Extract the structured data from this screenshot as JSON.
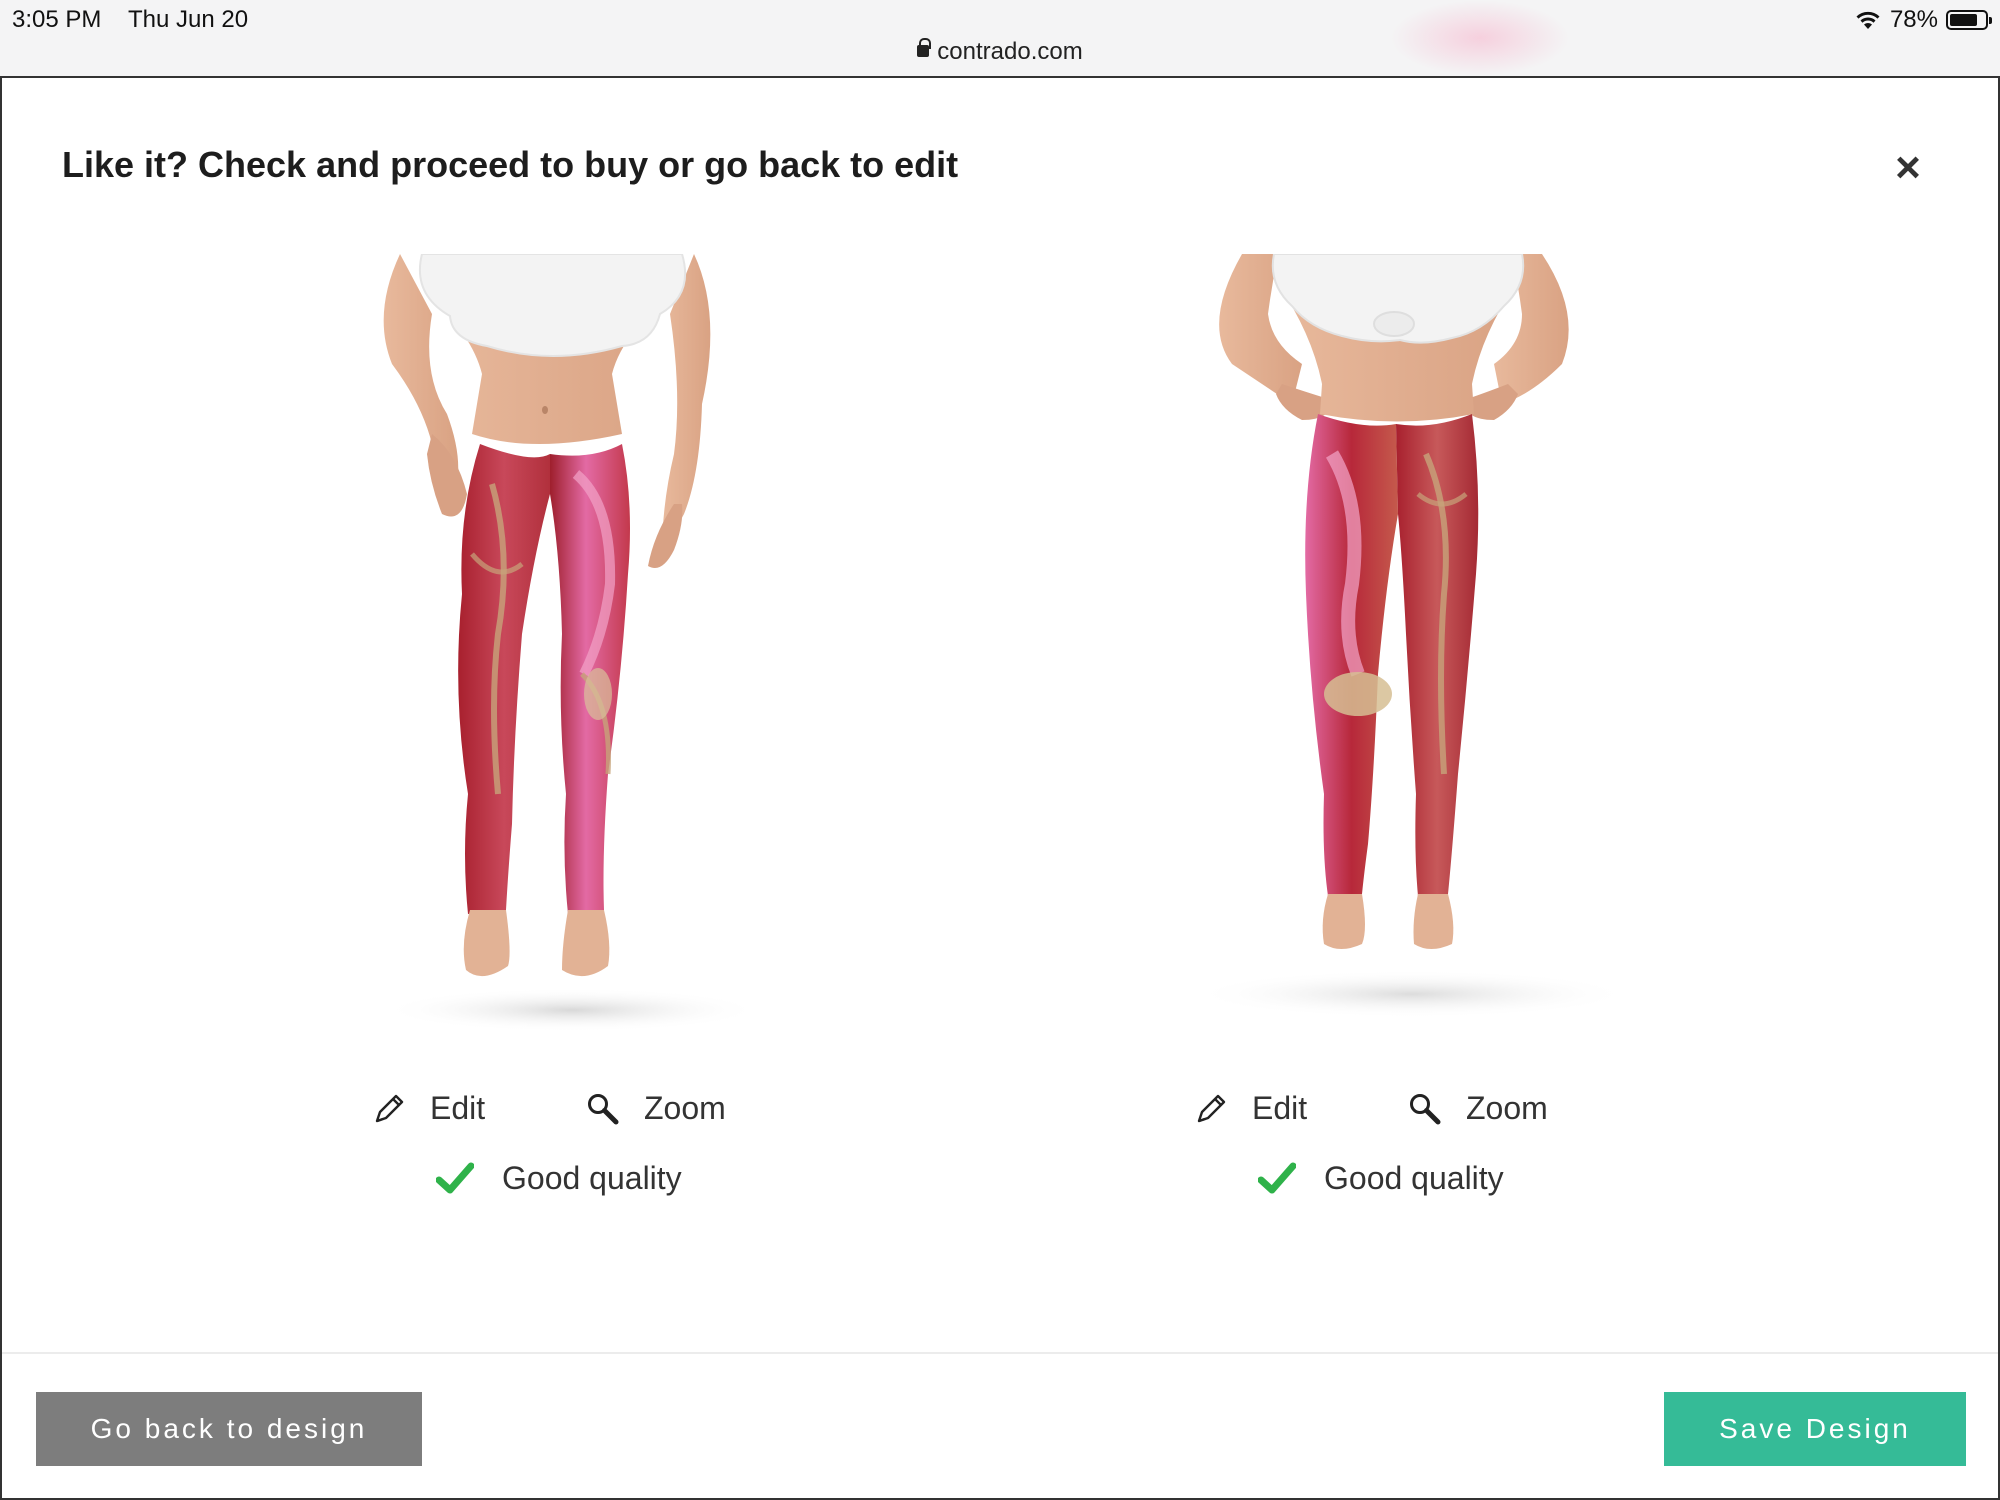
{
  "status_bar": {
    "time": "3:05 PM",
    "date": "Thu Jun 20",
    "url": "contrado.com",
    "battery_percent": "78%",
    "battery_level": 0.78,
    "icons": [
      "lock-icon",
      "wifi-icon",
      "battery-icon"
    ]
  },
  "modal": {
    "title": "Like it? Check and proceed to buy or go back to edit",
    "close_label": "×",
    "products": [
      {
        "view": "front",
        "image_icon": "leggings-front-image",
        "edit_label": "Edit",
        "zoom_label": "Zoom",
        "quality_label": "Good quality"
      },
      {
        "view": "back",
        "image_icon": "leggings-back-image",
        "edit_label": "Edit",
        "zoom_label": "Zoom",
        "quality_label": "Good quality"
      }
    ],
    "footer": {
      "back_label": "Go back to design",
      "save_label": "Save Design"
    }
  },
  "colors": {
    "save_button": "#35bb97",
    "back_button": "#7d7d7d",
    "check": "#2fb24a",
    "legging_red": "#b7283a",
    "legging_pink": "#e86aa8",
    "legging_tan": "#c7a47a"
  }
}
